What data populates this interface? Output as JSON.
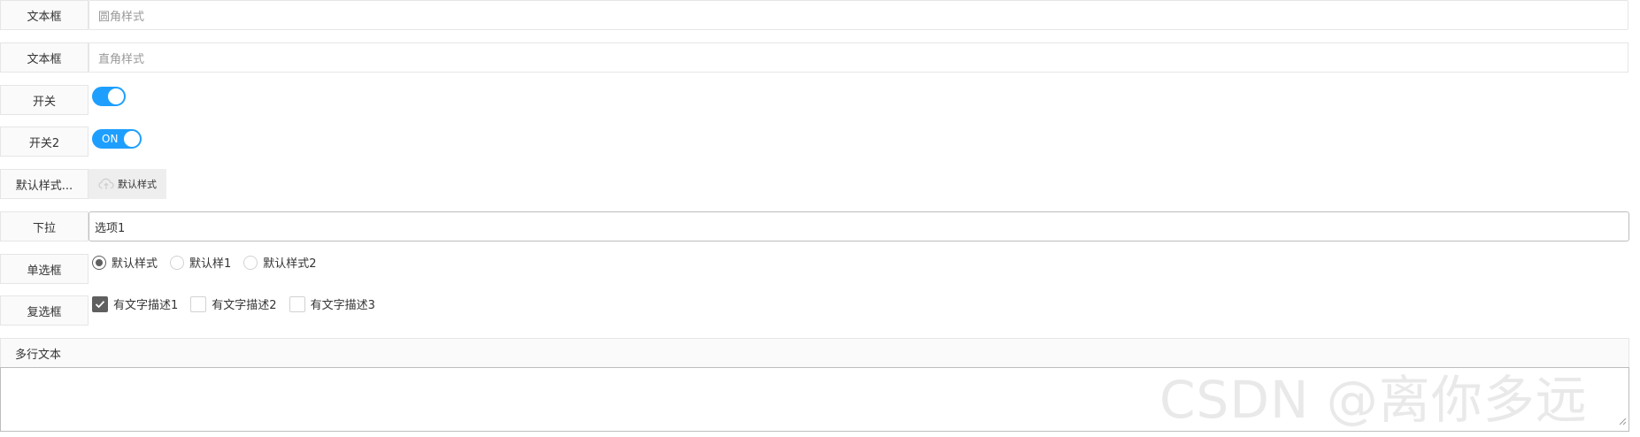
{
  "form": {
    "textbox_round": {
      "label": "文本框",
      "placeholder": "圆角样式"
    },
    "textbox_square": {
      "label": "文本框",
      "placeholder": "直角样式"
    },
    "switch1": {
      "label": "开关"
    },
    "switch2": {
      "label": "开关2",
      "text": "ON"
    },
    "upload": {
      "label": "默认样式...",
      "button_label": "默认样式"
    },
    "select": {
      "label": "下拉",
      "value": "选项1"
    },
    "radio": {
      "label": "单选框",
      "options": [
        "默认样式",
        "默认样1",
        "默认样式2"
      ]
    },
    "checkbox": {
      "label": "复选框",
      "options": [
        "有文字描述1",
        "有文字描述2",
        "有文字描述3"
      ]
    },
    "textarea": {
      "label": "多行文本"
    }
  },
  "watermark": "CSDN @离你多远",
  "colors": {
    "accent": "#1e9fff",
    "checked": "#5f5f5f"
  }
}
